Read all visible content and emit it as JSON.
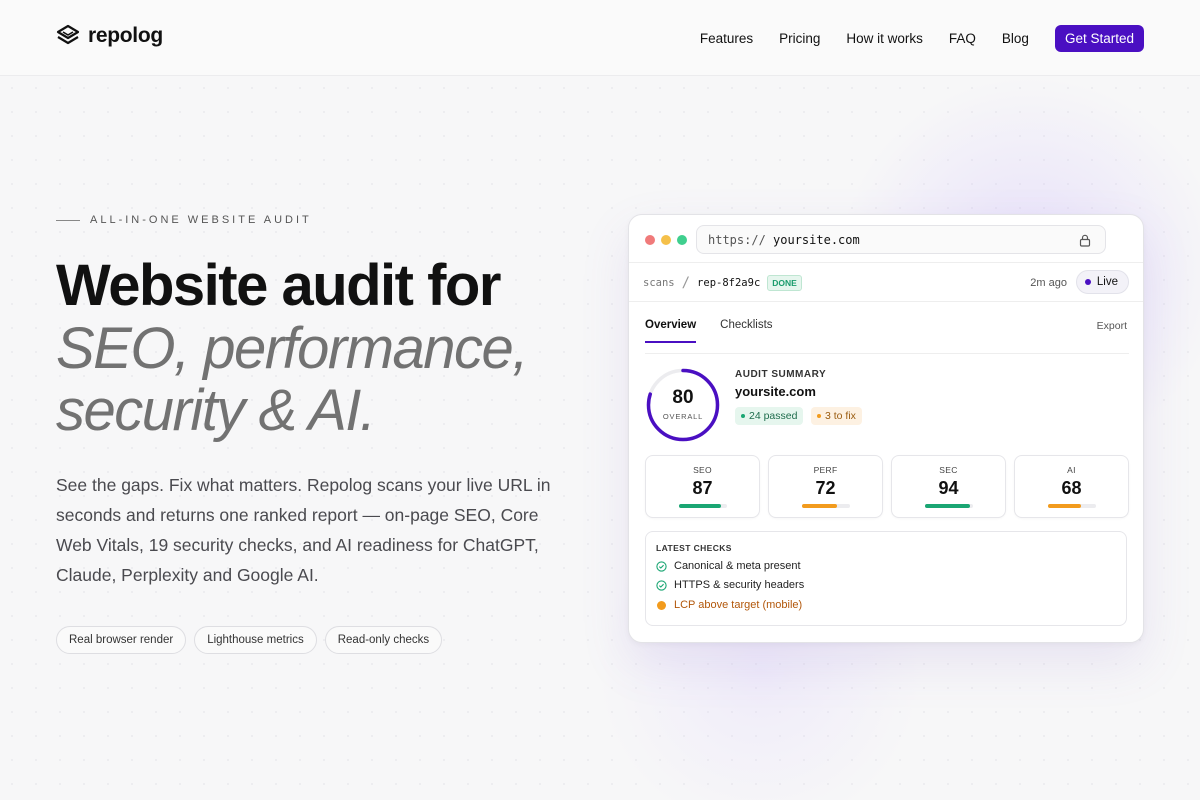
{
  "brand": {
    "name": "repolog",
    "accent": "#4a0fc2"
  },
  "nav": {
    "links": [
      "Features",
      "Pricing",
      "How it works",
      "FAQ",
      "Blog"
    ],
    "cta": "Get Started"
  },
  "hero": {
    "eyebrow": "ALL-IN-ONE WEBSITE AUDIT",
    "title_line1": "Website audit for",
    "title_line2": "SEO, performance,",
    "title_line3": "security & AI.",
    "lede": "See the gaps. Fix what matters. Repolog scans your live URL in seconds and returns one ranked report — on-page SEO, Core Web Vitals, 19 security checks, and AI readiness for ChatGPT, Claude, Perplexity and Google AI.",
    "chips": [
      "Real browser render",
      "Lighthouse metrics",
      "Read-only checks"
    ]
  },
  "card": {
    "url_scheme": "https://",
    "url_host": "yoursite.com",
    "breadcrumb_root": "scans",
    "breadcrumb_sep": "/",
    "scan_id": "rep-8f2a9c",
    "status": "DONE",
    "time_ago": "2m ago",
    "live_label": "Live",
    "tabs": [
      "Overview",
      "Checklists"
    ],
    "export_label": "Export",
    "score": {
      "value": 80,
      "label": "OVERALL",
      "max": 100
    },
    "summary_title": "AUDIT SUMMARY",
    "summary_site": "yoursite.com",
    "passed": "24 passed",
    "to_fix": "3 to fix",
    "metrics": [
      {
        "label": "SEO",
        "value": 87,
        "color": "#1aa673"
      },
      {
        "label": "PERF",
        "value": 72,
        "color": "#f29b1d"
      },
      {
        "label": "SEC",
        "value": 94,
        "color": "#1aa673"
      },
      {
        "label": "AI",
        "value": 68,
        "color": "#f29b1d"
      }
    ],
    "checks_title": "LATEST CHECKS",
    "checks": [
      {
        "text": "Canonical & meta present",
        "status": "pass"
      },
      {
        "text": "HTTPS & security headers",
        "status": "pass"
      },
      {
        "text": "LCP above target (mobile)",
        "status": "warn"
      }
    ]
  }
}
